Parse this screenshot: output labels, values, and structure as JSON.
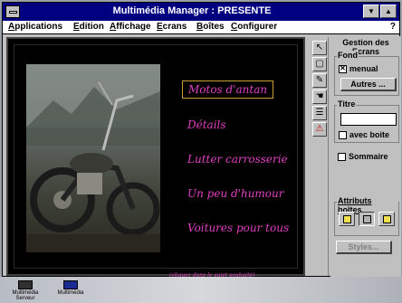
{
  "window": {
    "title": "Multimédia Manager : PRESENTE",
    "minimize_glyph": "▼",
    "maximize_glyph": "▲"
  },
  "menubar": {
    "items": [
      {
        "first": "A",
        "rest": "pplications"
      },
      {
        "first": "E",
        "rest": "dition"
      },
      {
        "first": "A",
        "rest": "ffichage"
      },
      {
        "first": "E",
        "rest": "crans"
      },
      {
        "first": "B",
        "rest": "oîtes"
      },
      {
        "first": "C",
        "rest": "onfigurer"
      }
    ],
    "help": "?"
  },
  "display": {
    "photo_subject": "motorcycle-photo",
    "menu_items": [
      "Motos d'antan",
      "Détails",
      "Lutter carrosserie",
      "Un peu d'humour",
      "Voitures pour tous"
    ],
    "selected_index": 0,
    "footnote": "(cliquez dans le sujet souhaité)",
    "text_color": "#e040c0"
  },
  "toolbar": {
    "tools": [
      {
        "name": "pointer-icon",
        "glyph": "↖"
      },
      {
        "name": "frame-icon",
        "glyph": "▢"
      },
      {
        "name": "pen-icon",
        "glyph": "✎"
      },
      {
        "name": "hand-icon",
        "glyph": "☚"
      },
      {
        "name": "list-icon",
        "glyph": "☰"
      },
      {
        "name": "warning-icon",
        "glyph": "⚠"
      }
    ]
  },
  "panel": {
    "title": "Gestion des Ecrans",
    "fond": {
      "label": "Fond",
      "manual_label": "menual",
      "manual_checked": true,
      "autres_button": "Autres ..."
    },
    "titre": {
      "label": "Titre",
      "field_value": "",
      "avec_boite_label": "avec boite",
      "avec_boite_checked": false
    },
    "sommaire": {
      "label": "Sommaire",
      "checked": false
    },
    "attributs": {
      "label": "Attributs boîtes",
      "selected_index": 1
    },
    "styles_button": "Styles..."
  },
  "desktop": {
    "icons": [
      {
        "line1": "Multimédia",
        "line2": "Serveur"
      },
      {
        "line1": "Multimédia",
        "line2": ""
      }
    ]
  },
  "colors": {
    "titlebar": "#000080",
    "chrome": "#c0c0c0",
    "selection_border": "#c8a030"
  }
}
